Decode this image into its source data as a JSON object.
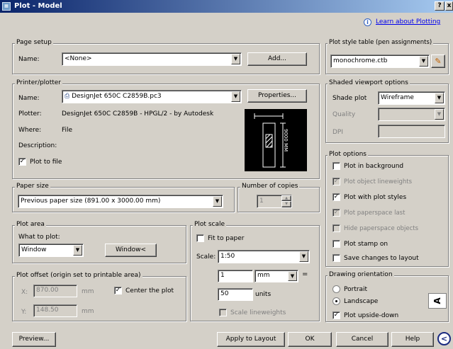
{
  "window": {
    "title": "Plot - Model",
    "help_label": "?",
    "close_label": "x"
  },
  "info": {
    "link": "Learn about Plotting"
  },
  "page_setup": {
    "group": "Page setup",
    "name_label": "Name:",
    "name_value": "<None>",
    "add_label": "Add..."
  },
  "printer": {
    "group": "Printer/plotter",
    "name_label": "Name:",
    "name_value": "DesignJet 650C C2859B.pc3",
    "properties_label": "Properties...",
    "plotter_label": "Plotter:",
    "plotter_value": "DesignJet 650C C2859B - HPGL/2 - by Autodesk",
    "where_label": "Where:",
    "where_value": "File",
    "description_label": "Description:",
    "plot_to_file_label": "Plot to file",
    "plot_to_file_checked": true,
    "preview_dim": "9000 MM"
  },
  "paper_size": {
    "group": "Paper size",
    "value": "Previous paper size  (891.00 x 3000.00 mm)"
  },
  "copies": {
    "group": "Number of copies",
    "value": "1"
  },
  "plot_area": {
    "group": "Plot area",
    "what_label": "What to plot:",
    "what_value": "Window",
    "window_btn": "Window<"
  },
  "plot_offset": {
    "group": "Plot offset (origin set to printable area)",
    "x_label": "X:",
    "x_value": "870.00",
    "y_label": "Y:",
    "y_value": "148.50",
    "unit": "mm",
    "center_label": "Center the plot",
    "center_checked": true
  },
  "plot_scale": {
    "group": "Plot scale",
    "fit_label": "Fit to paper",
    "fit_checked": false,
    "scale_label": "Scale:",
    "scale_value": "1:50",
    "num_value": "1",
    "unit_value": "mm",
    "equals": "=",
    "den_value": "50",
    "den_unit": "units",
    "lw_label": "Scale lineweights"
  },
  "style_table": {
    "group": "Plot style table (pen assignments)",
    "value": "monochrome.ctb"
  },
  "shaded": {
    "group": "Shaded viewport options",
    "shade_label": "Shade plot",
    "shade_value": "Wireframe",
    "quality_label": "Quality",
    "dpi_label": "DPI"
  },
  "options": {
    "group": "Plot options",
    "items": [
      {
        "label": "Plot in background",
        "checked": false,
        "disabled": false
      },
      {
        "label": "Plot object lineweights",
        "checked": true,
        "disabled": true
      },
      {
        "label": "Plot with plot styles",
        "checked": true,
        "disabled": false
      },
      {
        "label": "Plot paperspace last",
        "checked": true,
        "disabled": true
      },
      {
        "label": "Hide paperspace objects",
        "checked": false,
        "disabled": true
      },
      {
        "label": "Plot stamp on",
        "checked": false,
        "disabled": false
      },
      {
        "label": "Save changes to layout",
        "checked": false,
        "disabled": false
      }
    ]
  },
  "orientation": {
    "group": "Drawing orientation",
    "portrait": "Portrait",
    "landscape": "Landscape",
    "selected": "Landscape",
    "upside_label": "Plot upside-down",
    "upside_checked": true,
    "icon_glyph": "A"
  },
  "footer": {
    "preview": "Preview...",
    "apply": "Apply to Layout",
    "ok": "OK",
    "cancel": "Cancel",
    "help": "Help",
    "more_glyph": "<"
  }
}
